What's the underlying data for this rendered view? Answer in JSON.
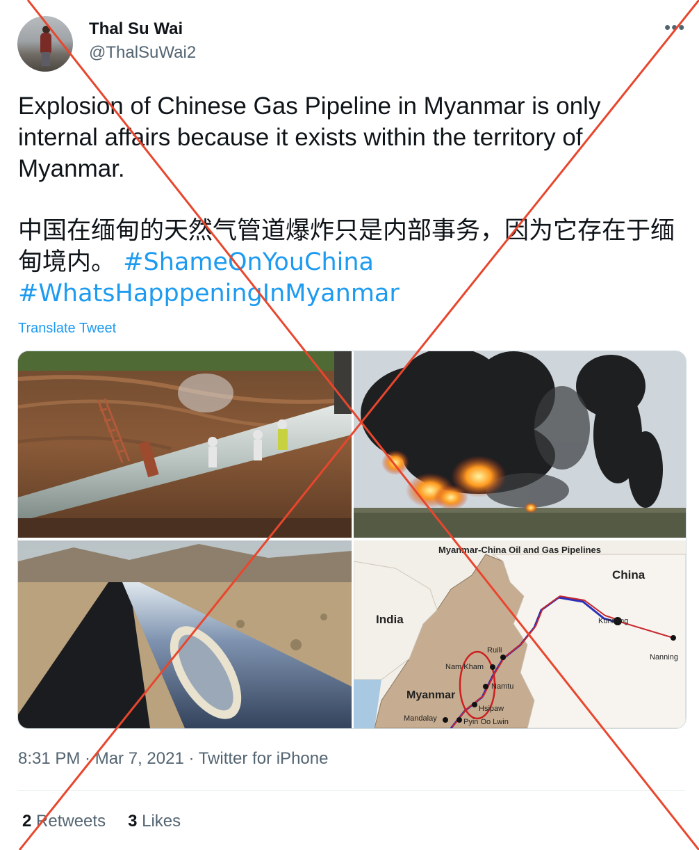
{
  "author": {
    "name": "Thal Su Wai",
    "handle": "@ThalSuWai2"
  },
  "more_icon": "more-horizontal-icon",
  "tweet": {
    "text_en": "Explosion of Chinese Gas Pipeline in Myanmar is only internal affairs because it exists within the territory of Myanmar.",
    "text_zh": "中国在缅甸的天然气管道爆炸只是内部事务，因为它存在于缅甸境内。",
    "hashtags": [
      "#ShameOnYouChina",
      "#WhatsHapppeningInMyanmar"
    ],
    "translate_label": "Translate Tweet"
  },
  "media": {
    "map": {
      "title": "Myanmar-China Oil and Gas Pipelines",
      "countries": [
        "China",
        "India",
        "Myanmar"
      ],
      "cities": [
        "Kunming",
        "Nanning",
        "Ruili",
        "Nam Kham",
        "Namtu",
        "Hsipaw",
        "Mandalay",
        "Pyin Oo Lwin"
      ]
    }
  },
  "meta": {
    "time": "8:31 PM",
    "date": "Mar 7, 2021",
    "source": "Twitter for iPhone"
  },
  "stats": {
    "retweets_count": "2",
    "retweets_label": "Retweets",
    "likes_count": "3",
    "likes_label": "Likes"
  },
  "colors": {
    "link": "#1d9bf0",
    "secondary": "#536471",
    "overlay_cross": "#e8462d"
  }
}
